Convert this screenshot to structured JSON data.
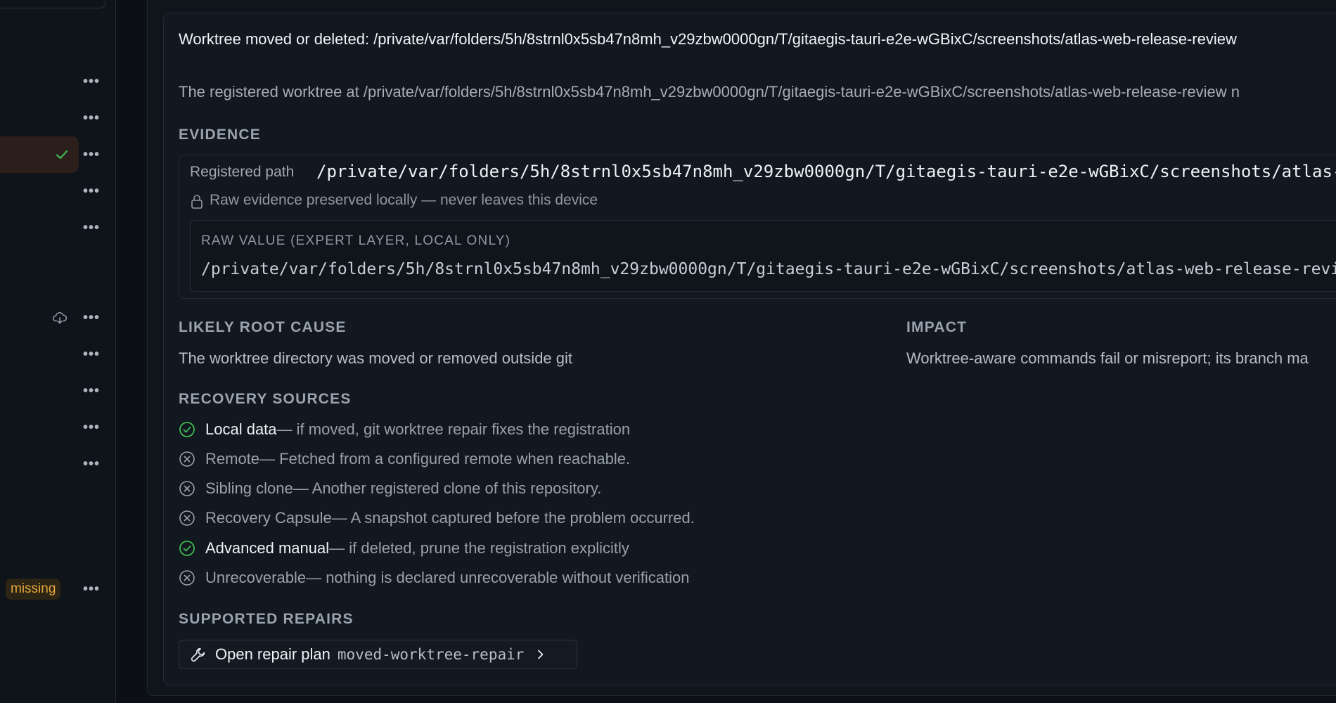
{
  "sidebar": {
    "rows": [
      {
        "status": "",
        "more": "•••"
      },
      {
        "status": "",
        "more": "•••"
      },
      {
        "status": "check-icon",
        "more": "•••",
        "active": true
      },
      {
        "status": "",
        "more": "•••"
      },
      {
        "status": "",
        "more": "•••"
      },
      {
        "status": "cloud-download-icon",
        "more": "•••"
      },
      {
        "status": "",
        "more": "•••"
      },
      {
        "status": "",
        "more": "•••"
      },
      {
        "status": "",
        "more": "•••"
      },
      {
        "status": "",
        "more": "•••"
      },
      {
        "status": "",
        "more": "•••",
        "badge": "missing"
      }
    ],
    "missing_badge": "missing"
  },
  "issue": {
    "title": "Worktree moved or deleted: /private/var/folders/5h/8strnl0x5sb47n8mh_v29zbw0000gn/T/gitaegis-tauri-e2e-wGBixC/screenshots/atlas-web-release-review",
    "description": "The registered worktree at /private/var/folders/5h/8strnl0x5sb47n8mh_v29zbw0000gn/T/gitaegis-tauri-e2e-wGBixC/screenshots/atlas-web-release-review n"
  },
  "evidence": {
    "heading": "EVIDENCE",
    "registered_label": "Registered path",
    "registered_value": "/private/var/folders/5h/8strnl0x5sb47n8mh_v29zbw0000gn/T/gitaegis-tauri-e2e-wGBixC/screenshots/atlas-",
    "privacy_note": "Raw evidence preserved locally — never leaves this device",
    "raw_label": "RAW VALUE (EXPERT LAYER, LOCAL ONLY)",
    "raw_value": "/private/var/folders/5h/8strnl0x5sb47n8mh_v29zbw0000gn/T/gitaegis-tauri-e2e-wGBixC/screenshots/atlas-web-release-revi"
  },
  "root_cause": {
    "heading": "LIKELY ROOT CAUSE",
    "text": "The worktree directory was moved or removed outside git"
  },
  "impact": {
    "heading": "IMPACT",
    "text": "Worktree-aware commands fail or misreport; its branch ma"
  },
  "recovery": {
    "heading": "RECOVERY SOURCES",
    "items": [
      {
        "name": "Local data",
        "detail": " — if moved, git worktree repair fixes the registration",
        "available": true
      },
      {
        "name": "Remote",
        "detail": " — Fetched from a configured remote when reachable.",
        "available": false
      },
      {
        "name": "Sibling clone",
        "detail": " — Another registered clone of this repository.",
        "available": false
      },
      {
        "name": "Recovery Capsule",
        "detail": " — A snapshot captured before the problem occurred.",
        "available": false
      },
      {
        "name": "Advanced manual",
        "detail": " — if deleted, prune the registration explicitly",
        "available": true
      },
      {
        "name": "Unrecoverable",
        "detail": " — nothing is declared unrecoverable without verification",
        "available": false
      }
    ]
  },
  "repairs": {
    "heading": "SUPPORTED REPAIRS",
    "button_label": "Open repair plan",
    "button_code": "moved-worktree-repair"
  },
  "colors": {
    "ok": "#3fb950",
    "unavailable": "#9aa2ad",
    "warning": "#e5a739",
    "active_row": "#2c1e1a"
  }
}
